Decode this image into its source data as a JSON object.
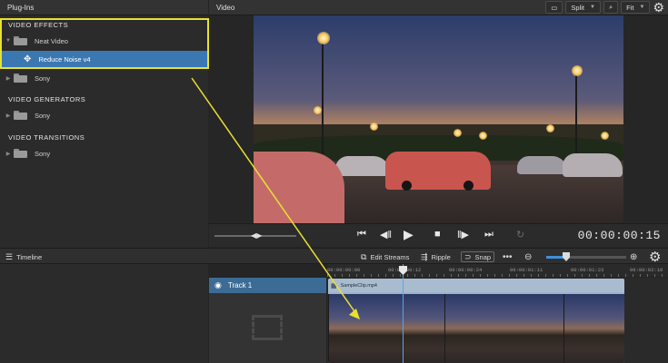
{
  "plugins_panel": {
    "title": "Plug-Ins",
    "sections": {
      "effects": "VIDEO EFFECTS",
      "generators": "VIDEO GENERATORS",
      "transitions": "VIDEO TRANSITIONS"
    },
    "effects_items": {
      "folder1": "Neat Video",
      "selected": "Reduce Noise v4",
      "folder2": "Sony"
    },
    "generators_items": {
      "folder": "Sony"
    },
    "transitions_items": {
      "folder": "Sony"
    }
  },
  "video_panel": {
    "title": "Video",
    "split_label": "Split",
    "fit_label": "Fit",
    "icons": [
      "split-view-icon",
      "search-icon",
      "gear-icon"
    ]
  },
  "transport": {
    "timecode": "00:00:00:15",
    "icons": [
      "go-start-icon",
      "step-back-icon",
      "play-icon",
      "stop-icon",
      "step-forward-icon",
      "go-end-icon",
      "loop-icon"
    ]
  },
  "timeline": {
    "label": "Timeline",
    "edit_streams": "Edit Streams",
    "ripple": "Ripple",
    "snap": "Snap",
    "more": "•••",
    "zoom_level": 0.25,
    "ruler": [
      "00:00:00:00",
      "00:00:00:12",
      "00:00:00:24",
      "00:00:01:11",
      "00:00:01:23",
      "00:00:02:10"
    ],
    "track_name": "Track 1",
    "clip_name": "SampleClip.mp4"
  },
  "colors": {
    "selection": "#3b78b2",
    "annotation": "#e8e033",
    "accent": "#3f8fd8"
  }
}
